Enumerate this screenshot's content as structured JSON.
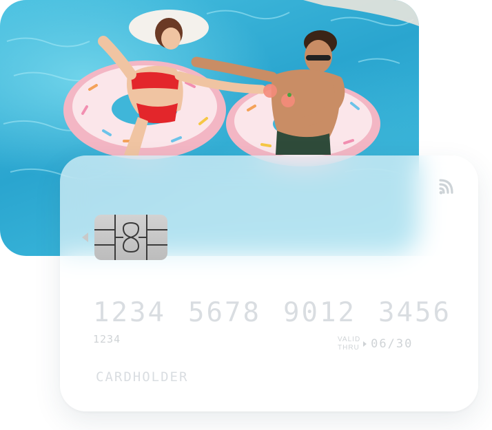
{
  "card": {
    "number_groups": [
      "1234",
      "5678",
      "9012",
      "3456"
    ],
    "short_number": "1234",
    "valid_label_top": "VALID",
    "valid_label_bottom": "THRU",
    "expiry": "06/30",
    "holder": "CARDHOLDER"
  },
  "icons": {
    "contactless": "contactless-icon",
    "chip": "chip-icon"
  },
  "colors": {
    "pool": "#2aa5cf",
    "card_text": "#d9dde1",
    "chip": "#c4c4c4"
  }
}
